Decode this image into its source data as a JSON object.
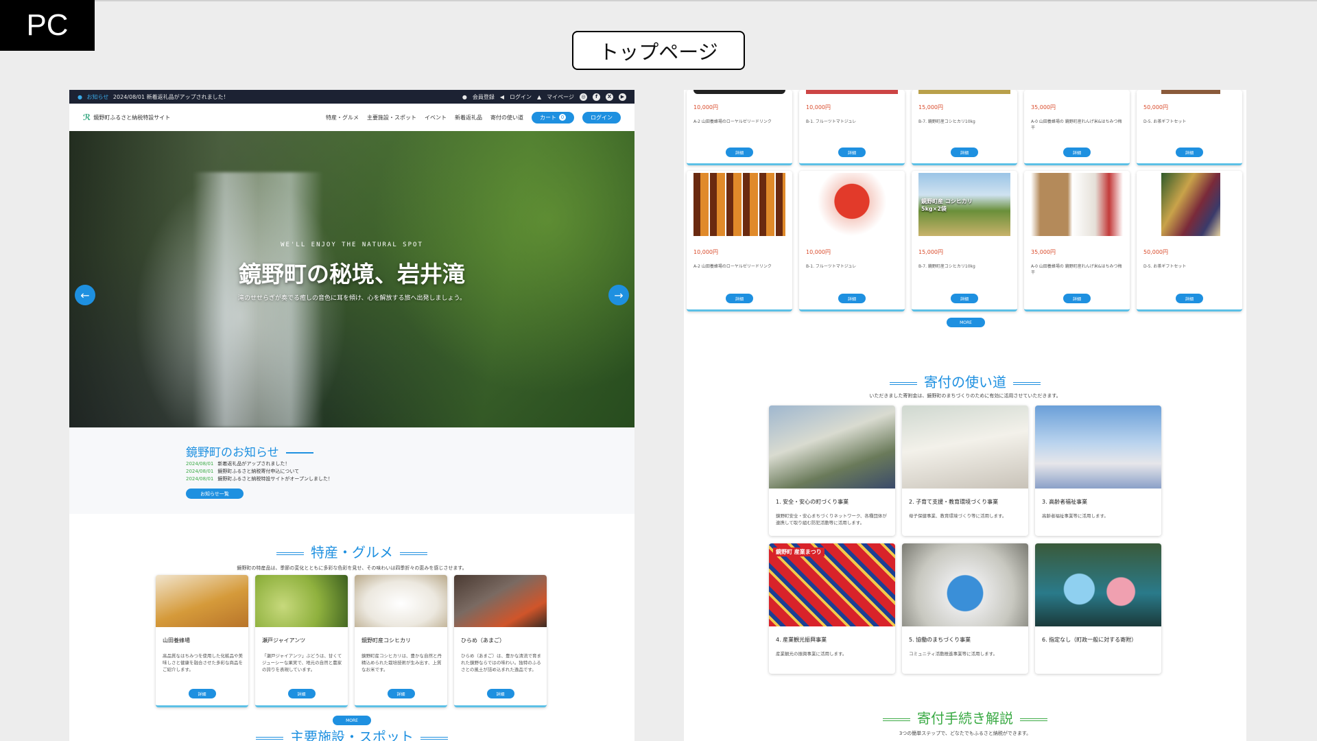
{
  "badge": "PC",
  "page_label": "トップページ",
  "notice_bar": {
    "label": "お知らせ",
    "text": "2024/08/01 新着返礼品がアップされました！",
    "links": [
      "会員登録",
      "ログイン",
      "マイページ"
    ],
    "social": [
      "◎",
      "f",
      "X",
      "▶"
    ]
  },
  "header": {
    "logo_text": "鏡野町ふるさと納税特設サイト",
    "nav": [
      "特産・グルメ",
      "主要施設・スポット",
      "イベント",
      "新着返礼品",
      "寄付の使い道"
    ],
    "cart_label": "カート",
    "cart_count": "0",
    "login_label": "ログイン"
  },
  "hero": {
    "subtitle": "WE'LL ENJOY THE NATURAL SPOT",
    "title": "鏡野町の秘境、岩井滝",
    "description": "滝のせせらぎが奏でる癒しの音色に耳を傾け、心を解放する旅へ出発しましょう。",
    "prev": "←",
    "next": "→"
  },
  "news": {
    "title": "鏡野町のお知らせ",
    "items": [
      {
        "date": "2024/08/01",
        "text": "新着返礼品がアップされました！"
      },
      {
        "date": "2024/08/01",
        "text": "鏡野町ふるさと納税寄付申込について"
      },
      {
        "date": "2024/08/01",
        "text": "鏡野町ふるさと納税特設サイトがオープンしました！"
      }
    ],
    "more": "お知らせ一覧"
  },
  "gourmet": {
    "title": "特産・グルメ",
    "description": "鏡野町の特産品は、季節の変化とともに多彩な色彩を見せ、その味わいは四季折々の恵みを感じさせます。",
    "cards": [
      {
        "name": "山田養蜂場",
        "desc": "高品質なはちみつを使用した化粧品や美味しさと健康を融合させた多彩な商品をご紹介します。",
        "btn": "詳細"
      },
      {
        "name": "瀬戸ジャイアンツ",
        "desc": "「瀬戸ジャイアンツ」ぶどうは、甘くてジューシーな果実で、地元の自然と農家の誇りを表現しています。",
        "btn": "詳細"
      },
      {
        "name": "鏡野町産コシヒカリ",
        "desc": "鏡野町産コシヒカリは、豊かな自然と丹精込められた栽培技術が生み出す、上質なお米です。",
        "btn": "詳細"
      },
      {
        "name": "ひらめ（あまご）",
        "desc": "ひらめ（あまご）は、豊かな清流で育まれた鏡野ならではの味わい。独特のふるさとの風土が詰め込まれた逸品です。",
        "btn": "詳細"
      }
    ],
    "more": "MORE"
  },
  "facilities": {
    "title": "主要施設・スポット"
  },
  "products": {
    "rows": [
      [
        {
          "price": "10,000円",
          "name": "A-2 山田養蜂場のローヤルゼリードリンク",
          "btn": "詳細"
        },
        {
          "price": "10,000円",
          "name": "B-1. フルーツトマトジュレ",
          "btn": "詳細"
        },
        {
          "price": "15,000円",
          "name": "B-7. 鏡野町産コシヒカリ10kg",
          "btn": "詳細"
        },
        {
          "price": "35,000円",
          "name": "A-0 山田養蜂場の 鏡野町産れんげ米&はちみつ梅干",
          "btn": "詳細"
        },
        {
          "price": "50,000円",
          "name": "D-5. お茶ギフトセット",
          "btn": "詳細"
        }
      ],
      [
        {
          "price": "10,000円",
          "name": "A-2 山田養蜂場のローヤルゼリードリンク",
          "btn": "詳細",
          "label": ""
        },
        {
          "price": "10,000円",
          "name": "B-1. フルーツトマトジュレ",
          "btn": "詳細",
          "label": ""
        },
        {
          "price": "15,000円",
          "name": "B-7. 鏡野町産コシヒカリ10kg",
          "btn": "詳細",
          "label": "鏡野町産 コシヒカリ 5kg×2袋"
        },
        {
          "price": "35,000円",
          "name": "A-0 山田養蜂場の 鏡野町産れんげ米&はちみつ梅干",
          "btn": "詳細",
          "label": ""
        },
        {
          "price": "50,000円",
          "name": "D-5. お茶ギフトセット",
          "btn": "詳細",
          "label": ""
        }
      ]
    ],
    "more": "MORE"
  },
  "usage": {
    "title": "寄付の使い道",
    "description": "いただきました寄附金は、鏡野町のまちづくりのために有効に活用させていただきます。",
    "cards": [
      {
        "title": "1. 安全・安心の町づくり事業",
        "desc": "鏡野町安全・安心まちづくりネットワーク、各種団体が連携して取り組む防犯活動等に活用します。"
      },
      {
        "title": "2. 子育て支援・教育環境づくり事業",
        "desc": "母子保健事業、教育環境づくり等に活用します。"
      },
      {
        "title": "3. 高齢者福祉事業",
        "desc": "高齢者福祉事業等に活用します。"
      },
      {
        "title": "4. 産業観光振興事業",
        "desc": "産業観光の振興事業に活用します。"
      },
      {
        "title": "5. 協働のまちづくり事業",
        "desc": "コミュニティ活動推進事業等に活用します。"
      },
      {
        "title": "6. 指定なし（町政一般に対する寄附）",
        "desc": ""
      }
    ],
    "photo_banner": "鏡野町 産業まつり"
  },
  "procedure": {
    "title": "寄付手続き解説",
    "description": "3つの簡単ステップで、どなたでもふるさと納税ができます。"
  },
  "colors": {
    "accent": "#1e90e0",
    "green": "#3aaa44",
    "price": "#d94a2a"
  }
}
